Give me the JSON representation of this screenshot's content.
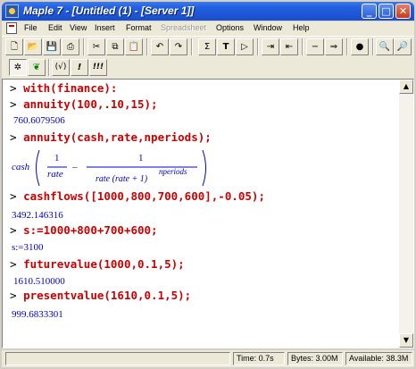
{
  "window": {
    "title": "Maple 7 - [Untitled (1) - [Server 1]]"
  },
  "title_buttons": {
    "minimize": "_",
    "maximize": "□",
    "close": "✕"
  },
  "menu": [
    "File",
    "Edit",
    "View",
    "Insert",
    "Format",
    "Spreadsheet",
    "Options",
    "Window",
    "Help"
  ],
  "menu_disabled": "Spreadsheet",
  "toolbar": {
    "text_button": "T",
    "math_button": "Σ",
    "exec_button": "!",
    "exec_all_button": "!!!",
    "restart_button": "(√)"
  },
  "worksheet": {
    "prompt": ">",
    "entries": [
      {
        "command": "with(finance):",
        "output": ""
      },
      {
        "command": "annuity(100,.10,15);",
        "output": "760.6079506"
      },
      {
        "command": "annuity(cash,rate,nperiods);",
        "output": ""
      },
      {
        "command": "cashflows([1000,800,700,600],-0.05);",
        "output": "3492.146316"
      },
      {
        "command": "s:=1000+800+700+600;",
        "output": "s:=3100"
      },
      {
        "command": "futurevalue(1000,0.1,5);",
        "output": "1610.510000"
      },
      {
        "command": "presentvalue(1610,0.1,5);",
        "output": "999.6833301"
      }
    ],
    "formula": {
      "lhs": "cash",
      "num1": "1",
      "den1": "rate",
      "minus": "–",
      "num2": "1",
      "den2": "rate (rate + 1)",
      "exponent": "nperiods"
    }
  },
  "status": {
    "time": "Time:  0.7s",
    "bytes": "Bytes: 3.00M",
    "available": "Available: 38.3M"
  }
}
